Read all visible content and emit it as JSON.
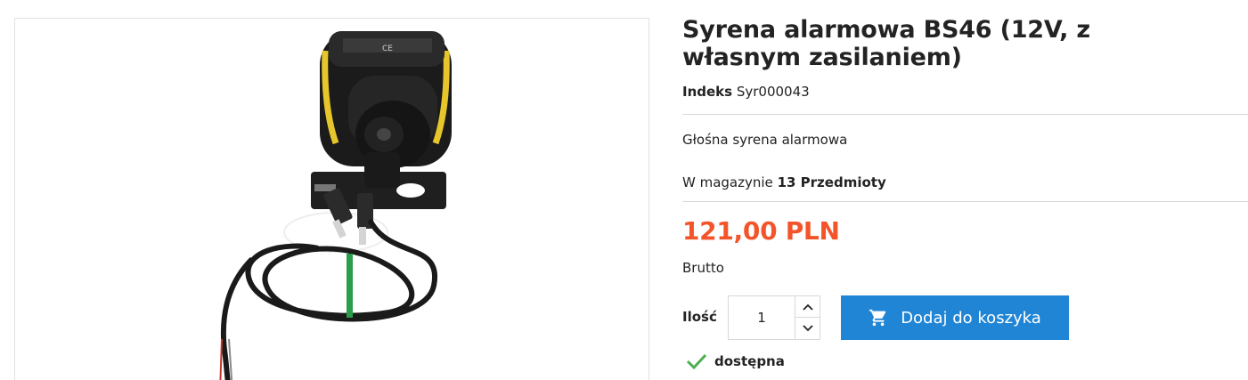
{
  "product": {
    "title": "Syrena alarmowa BS46 (12V, z własnym zasilaniem)",
    "reference_label": "Indeks",
    "reference_value": "Syr000043",
    "short_description": "Głośna syrena alarmowa",
    "stock_label": "W magazynie",
    "stock_value": "13 Przedmioty",
    "price": "121,00 PLN",
    "tax_label": "Brutto",
    "availability": "dostępna",
    "image_alt": "Syrena alarmowa BS46",
    "image_printed_marks": "CE"
  },
  "cart": {
    "quantity_label": "Ilość",
    "quantity_value": "1",
    "add_to_cart_label": "Dodaj do koszyka"
  },
  "icons": {
    "cart": "shopping-cart-icon",
    "check": "check-icon",
    "up": "chevron-up-icon",
    "down": "chevron-down-icon"
  },
  "colors": {
    "price": "#f4542a",
    "button": "#2185d5",
    "check": "#4caf50"
  }
}
